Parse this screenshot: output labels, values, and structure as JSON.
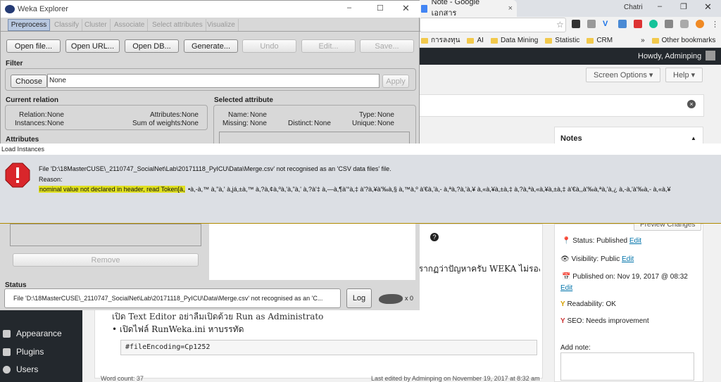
{
  "weka": {
    "title": "Weka Explorer",
    "tabs": [
      "Preprocess",
      "Classify",
      "Cluster",
      "Associate",
      "Select attributes",
      "Visualize"
    ],
    "buttons": {
      "open_file": "Open file...",
      "open_url": "Open URL...",
      "open_db": "Open DB...",
      "generate": "Generate...",
      "undo": "Undo",
      "edit": "Edit...",
      "save": "Save..."
    },
    "filter": {
      "heading": "Filter",
      "choose": "Choose",
      "value": "None",
      "apply": "Apply"
    },
    "current_relation": {
      "heading": "Current relation",
      "relation_label": "Relation:",
      "relation": "None",
      "instances_label": "Instances:",
      "instances": "None",
      "attributes_label": "Attributes:",
      "attributes": "None",
      "weights_label": "Sum of weights:",
      "weights": "None"
    },
    "selected_attribute": {
      "heading": "Selected attribute",
      "name_label": "Name:",
      "name": "None",
      "type_label": "Type:",
      "type": "None",
      "missing_label": "Missing:",
      "missing": "None",
      "distinct_label": "Distinct:",
      "distinct": "None",
      "unique_label": "Unique:",
      "unique": "None"
    },
    "attributes_heading": "Attributes",
    "remove": "Remove",
    "status": {
      "heading": "Status",
      "text": "File 'D:\\18MasterCUSE\\_2110747_SocialNet\\Lab\\20171118_PyICU\\Data\\Merge.csv' not recognised as an 'C...",
      "log": "Log",
      "count": "x 0"
    }
  },
  "dialog": {
    "title": "Load Instances",
    "line1": "File 'D:\\18MasterCUSE\\_2110747_SocialNet\\Lab\\20171118_PyICU\\Data\\Merge.csv' not recognised as an 'CSV data files' file.",
    "line2": "Reason:",
    "highlight": "nominal value not declared in header, read Token[à,",
    "garbled": "•à,-à,™ à,\"à,' à,já,±à,™ à,?à,¢à,ºà,'à,\"à,' à,?à'‡ à,—à,¶à'°à,‡ à'?à,¥à'‰à,§ à,™à,º à'€à,'à,- à,ªà,?à,'à,¥ à,«à,¥à,±à,‡ à,?à,ªà,«à,¥à,±à,‡ à'€à,,à'‰à,ªà,'à,¿ à,-à,'à'‰à,- à,«à,¥"
  },
  "chrome": {
    "tab_title": "Note - Google เอกสาร",
    "user": "Chatri",
    "bookmarks": [
      "การลงทุน",
      "AI",
      "Data Mining",
      "Statistic",
      "CRM",
      "Other bookmarks"
    ],
    "more": "»"
  },
  "wp": {
    "howdy": "Howdy, Adminping",
    "screen_options": "Screen Options ▾",
    "help": "Help ▾",
    "notes": "Notes",
    "status": "Status: Published",
    "visibility": "Visibility: Public",
    "published": "Published on: Nov 19, 2017 @ 08:32",
    "edit": "Edit",
    "readability": "Readability: OK",
    "seo": "SEO: Needs improvement",
    "add_note": "Add note:",
    "preview_changes": "Preview Changes",
    "menu": [
      "Appearance",
      "Plugins",
      "Users"
    ],
    "content_line": "ปรากฏว่าปัญหาครับ WEKA ไม่รองรับ",
    "bullet1": "เปิด Text Editor อย่าลืมเปิดด้วย Run as Administrator",
    "bullet2": "เปิดไฟล์ RunWeka.ini หาบรรทัด",
    "code": "#fileEncoding=Cp1252",
    "word_count": "Word count: 37",
    "last_edited": "Last edited by Adminping on November 19, 2017 at 8:32 am"
  }
}
